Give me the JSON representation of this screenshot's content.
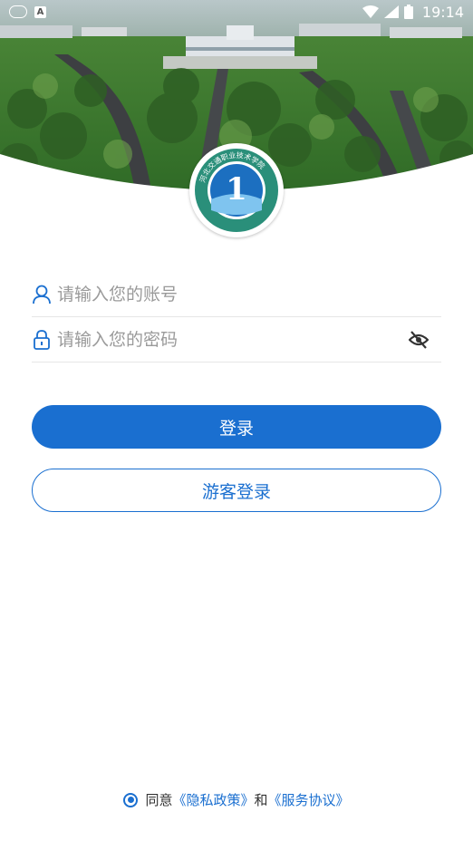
{
  "status_bar": {
    "time": "19:14",
    "a_icon_text": "A"
  },
  "logo": {
    "ring_text": "河北交通职业技术学院",
    "emblem_char": "1"
  },
  "form": {
    "account_placeholder": "请输入您的账号",
    "password_placeholder": "请输入您的密码"
  },
  "buttons": {
    "login": "登录",
    "guest_login": "游客登录"
  },
  "agreement": {
    "prefix": "同意",
    "privacy_link": "《隐私政策》",
    "conjunction": "和",
    "service_link": "《服务协议》",
    "checked": true
  },
  "colors": {
    "accent": "#1a6fd0",
    "divider": "#e6e6e6",
    "placeholder": "#9a9a9a"
  }
}
